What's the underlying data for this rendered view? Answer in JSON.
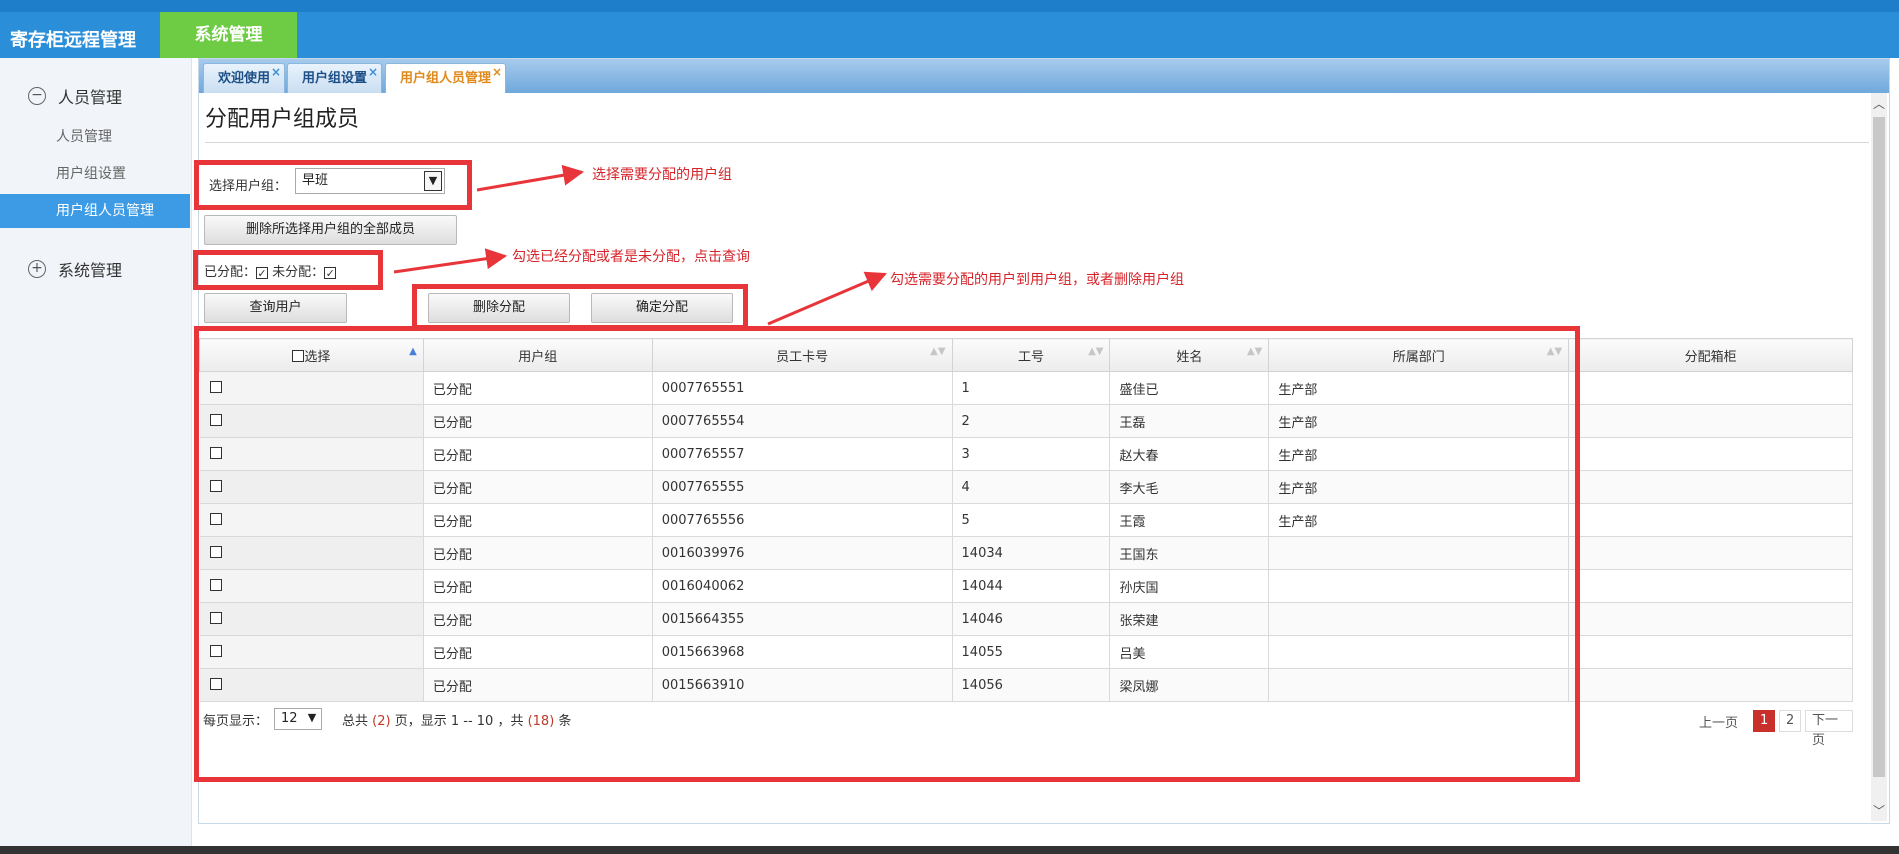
{
  "header": {
    "app_title": "寄存柜远程管理",
    "system_tab": "系统管理"
  },
  "sidebar": {
    "group1": {
      "toggle": "−",
      "label": "人员管理"
    },
    "items": [
      "人员管理",
      "用户组设置",
      "用户组人员管理"
    ],
    "group2": {
      "toggle": "+",
      "label": "系统管理"
    }
  },
  "tabs": [
    {
      "label": "欢迎使用",
      "close": "×"
    },
    {
      "label": "用户组设置",
      "close": "×"
    },
    {
      "label": "用户组人员管理",
      "close": "×"
    }
  ],
  "page_title": "分配用户组成员",
  "form": {
    "group_label": "选择用户组：",
    "group_value": "早班",
    "delete_all_button": "删除所选择用户组的全部成员",
    "assigned_label": "已分配：",
    "unassigned_label": "未分配：",
    "assigned_checked": "✓",
    "unassigned_checked": "✓",
    "query_button": "查询用户",
    "delete_assign_button": "删除分配",
    "confirm_assign_button": "确定分配"
  },
  "table": {
    "columns": [
      "选择",
      "用户组",
      "员工卡号",
      "工号",
      "姓名",
      "所属部门",
      "分配箱柜"
    ],
    "sort_icons": {
      "asc": "▲",
      "both": "▲▼"
    },
    "rows": [
      {
        "group": "已分配",
        "card": "0007765551",
        "num": "1",
        "name": "盛佳已",
        "dept": "生产部",
        "cabinet": ""
      },
      {
        "group": "已分配",
        "card": "0007765554",
        "num": "2",
        "name": "王磊",
        "dept": "生产部",
        "cabinet": ""
      },
      {
        "group": "已分配",
        "card": "0007765557",
        "num": "3",
        "name": "赵大春",
        "dept": "生产部",
        "cabinet": ""
      },
      {
        "group": "已分配",
        "card": "0007765555",
        "num": "4",
        "name": "李大毛",
        "dept": "生产部",
        "cabinet": ""
      },
      {
        "group": "已分配",
        "card": "0007765556",
        "num": "5",
        "name": "王霞",
        "dept": "生产部",
        "cabinet": ""
      },
      {
        "group": "已分配",
        "card": "0016039976",
        "num": "14034",
        "name": "王国东",
        "dept": "",
        "cabinet": ""
      },
      {
        "group": "已分配",
        "card": "0016040062",
        "num": "14044",
        "name": "孙庆国",
        "dept": "",
        "cabinet": ""
      },
      {
        "group": "已分配",
        "card": "0015664355",
        "num": "14046",
        "name": "张荣建",
        "dept": "",
        "cabinet": ""
      },
      {
        "group": "已分配",
        "card": "0015663968",
        "num": "14055",
        "name": "吕美",
        "dept": "",
        "cabinet": ""
      },
      {
        "group": "已分配",
        "card": "0015663910",
        "num": "14056",
        "name": "梁凤娜",
        "dept": "",
        "cabinet": ""
      }
    ]
  },
  "footer": {
    "per_page_label": "每页显示：",
    "per_page_value": "12",
    "summary_a": "总共",
    "total_pages": "(2)",
    "summary_b": "页，显示 1 -- 10 ，共",
    "total_rows": "(18)",
    "summary_c": "条",
    "prev": "上一页",
    "pages": [
      "1",
      "2"
    ],
    "next": "下一页"
  },
  "annotations": {
    "note1": "选择需要分配的用户组",
    "note2": "勾选已经分配或者是未分配，点击查询",
    "note3": "勾选需要分配的用户到用户组，或者删除用户组",
    "color": "#e8353a"
  },
  "scroll": {
    "up": "︿",
    "down": "﹀"
  }
}
